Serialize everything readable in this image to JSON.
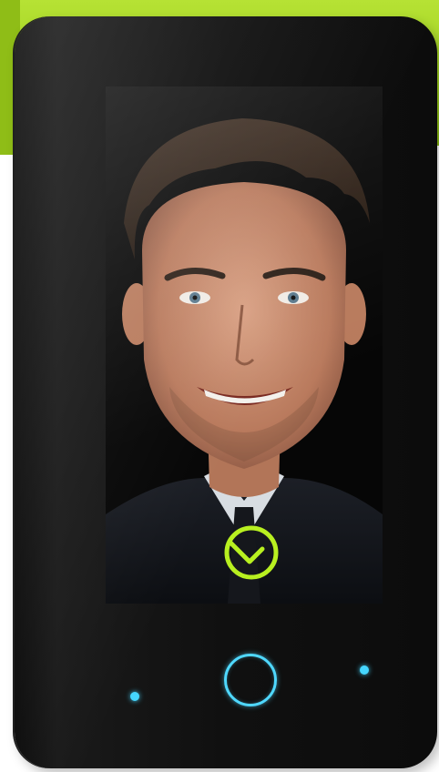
{
  "device": {
    "status": "face-verified",
    "icons": {
      "verify": "check-circle-icon",
      "home": "home-ring-icon"
    },
    "colors": {
      "background_accent": "#a6d82a",
      "verify_accent": "#b8f020",
      "indicator": "#45d6ff",
      "body": "#101010"
    }
  }
}
